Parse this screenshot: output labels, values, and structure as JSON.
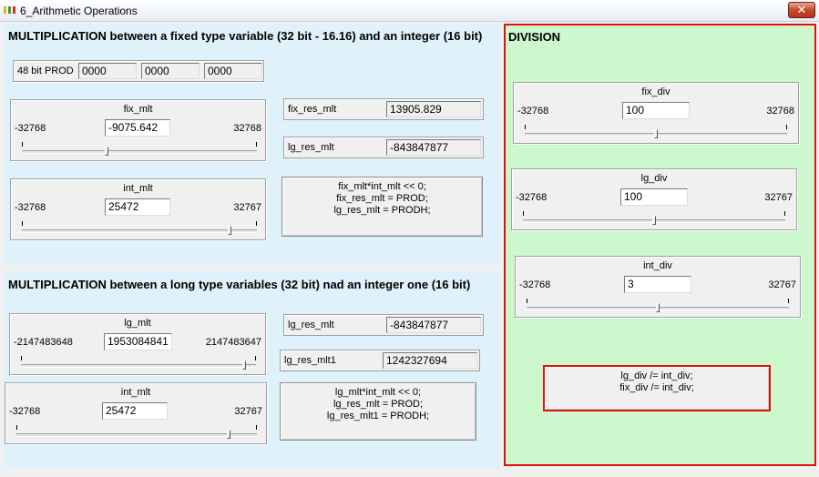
{
  "window": {
    "title": "6_Arithmetic Operations",
    "close_label": "✕",
    "icon_colors": [
      "#e0b020",
      "#30a030",
      "#d03030"
    ]
  },
  "mlt_fixed": {
    "heading": "MULTIPLICATION between a fixed type variable (32 bit - 16.16) and an integer (16 bit)",
    "prod": {
      "label": "48 bit PROD",
      "values": [
        "0000",
        "0000",
        "0000"
      ]
    },
    "fix_mlt": {
      "label": "fix_mlt",
      "min": "-32768",
      "max": "32768",
      "value": "-9075.642",
      "slider_fraction": 0.36
    },
    "int_mlt": {
      "label": "int_mlt",
      "min": "-32768",
      "max": "32767",
      "value": "25472",
      "slider_fraction": 0.89
    },
    "fix_res_mlt": {
      "label": "fix_res_mlt",
      "value": "13905.829"
    },
    "lg_res_mlt": {
      "label": "lg_res_mlt",
      "value": "-843847877"
    },
    "code": [
      "fix_mlt*int_mlt << 0;",
      "fix_res_mlt = PROD;",
      "lg_res_mlt = PRODH;"
    ]
  },
  "mlt_long": {
    "heading": "MULTIPLICATION between a long type variables (32 bit) nad an integer one (16 bit)",
    "lg_mlt": {
      "label": "lg_mlt",
      "min": "-2147483648",
      "max": "2147483647",
      "value": "1953084841",
      "slider_fraction": 0.955
    },
    "int_mlt": {
      "label": "int_mlt",
      "min": "-32768",
      "max": "32767",
      "value": "25472",
      "slider_fraction": 0.89
    },
    "lg_res_mlt": {
      "label": "lg_res_mlt",
      "value": "-843847877"
    },
    "lg_res_mlt1": {
      "label": "lg_res_mlt1",
      "value": "1242327694"
    },
    "code": [
      "lg_mlt*int_mlt << 0;",
      "lg_res_mlt = PROD;",
      "lg_res_mlt1 = PRODH;"
    ]
  },
  "division": {
    "heading": "DIVISION",
    "fix_div": {
      "label": "fix_div",
      "min": "-32768",
      "max": "32768",
      "value": "100",
      "slider_fraction": 0.5
    },
    "lg_div": {
      "label": "lg_div",
      "min": "-32768",
      "max": "32767",
      "value": "100",
      "slider_fraction": 0.5
    },
    "int_div": {
      "label": "int_div",
      "min": "-32768",
      "max": "32767",
      "value": "3",
      "slider_fraction": 0.5
    },
    "code": [
      "lg_div /= int_div;",
      "fix_div /= int_div;"
    ]
  }
}
